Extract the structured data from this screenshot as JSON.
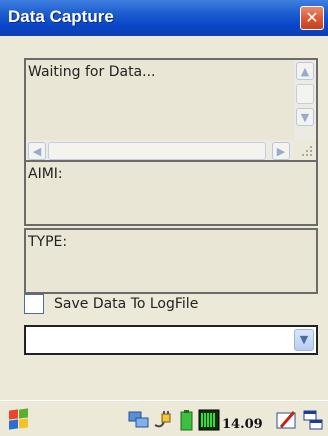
{
  "window": {
    "title": "Data Capture",
    "close_glyph": "✕"
  },
  "data_panel": {
    "text": "Waiting for Data..."
  },
  "aimi_panel": {
    "label": "AIMI:"
  },
  "type_panel": {
    "label": "TYPE:"
  },
  "save_checkbox": {
    "label": "Save Data To LogFile",
    "checked": false
  },
  "output_dropdown": {
    "selected": ""
  },
  "taskbar": {
    "clock": "14.09",
    "icons": [
      "start-windows-icon",
      "network-icon",
      "power-plug-icon",
      "battery-icon",
      "signal-meter-icon",
      "pen-input-icon",
      "window-switch-icon"
    ]
  },
  "colors": {
    "title_bar": "#0a46c8",
    "close_button": "#d9542e",
    "background": "#ece9d8"
  }
}
